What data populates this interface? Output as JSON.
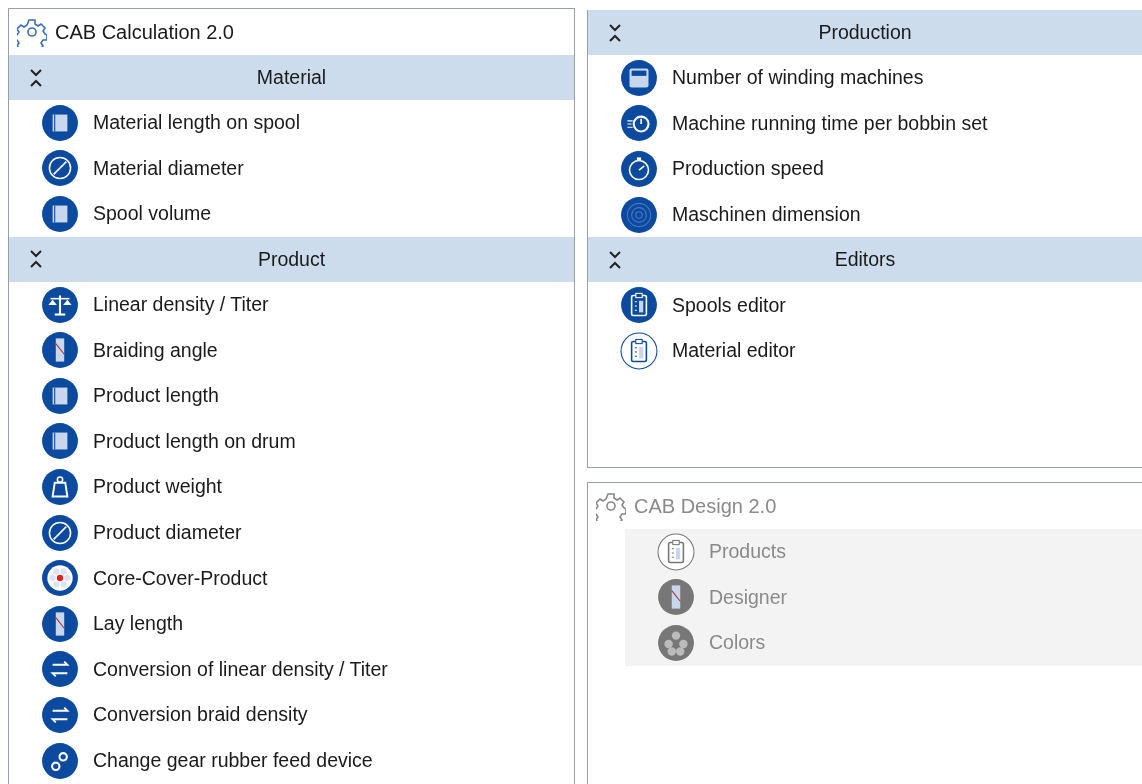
{
  "panels": [
    {
      "title": "CAB Calculation 2.0",
      "disabled": false,
      "sections": [
        {
          "title": "Material",
          "items": [
            "Material length on spool",
            "Material diameter",
            "Spool volume"
          ]
        },
        {
          "title": "Product",
          "items": [
            "Linear density / Titer",
            "Braiding angle",
            "Product length",
            "Product length on drum",
            "Product weight",
            "Product diameter",
            "Core-Cover-Product",
            "Lay length",
            "Conversion of linear density / Titer",
            "Conversion braid density",
            "Change gear rubber feed device"
          ]
        }
      ]
    },
    {
      "disabled": false,
      "sections": [
        {
          "title": "Production",
          "items": [
            "Number of winding machines",
            "Machine running time per bobbin set",
            "Production speed",
            "Maschinen dimension"
          ]
        },
        {
          "title": "Editors",
          "items": [
            "Spools editor",
            "Material editor"
          ]
        }
      ]
    },
    {
      "title": "CAB Design 2.0",
      "disabled": true,
      "items": [
        "Products",
        "Designer",
        "Colors"
      ]
    }
  ]
}
